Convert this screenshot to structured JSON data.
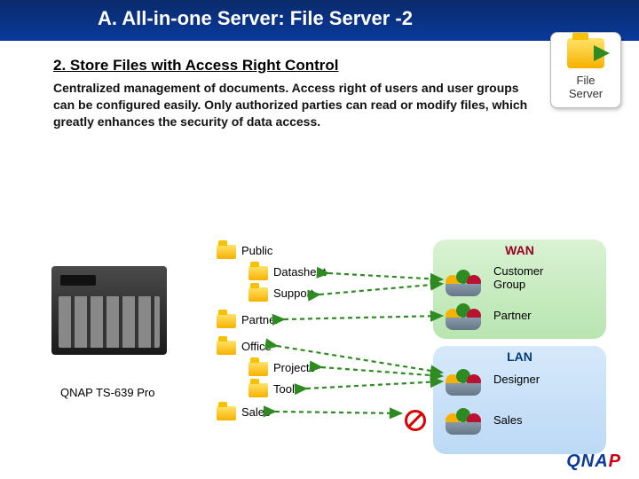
{
  "title": "A. All-in-one Server: File Server -2",
  "badge": {
    "line1": "File",
    "line2": "Server"
  },
  "subheading": "2. Store Files with Access Right Control",
  "description": "Centralized management of documents. Access right of users and user groups can be configured easily. Only authorized parties can read or modify files, which greatly enhances the security of data access.",
  "nas_label": "QNAP TS-639 Pro",
  "folders": {
    "public": "Public",
    "datasheet": "Datasheet",
    "support": "Support",
    "partner": "Partner",
    "office": "Office",
    "projects": "Projects",
    "tools": "Tools",
    "sales": "Sales"
  },
  "zones": {
    "wan": "WAN",
    "lan": "LAN"
  },
  "groups": {
    "customer": "Customer\nGroup",
    "partner": "Partner",
    "designer": "Designer",
    "sales": "Sales"
  },
  "brand": {
    "a": "QNA",
    "b": "P"
  }
}
